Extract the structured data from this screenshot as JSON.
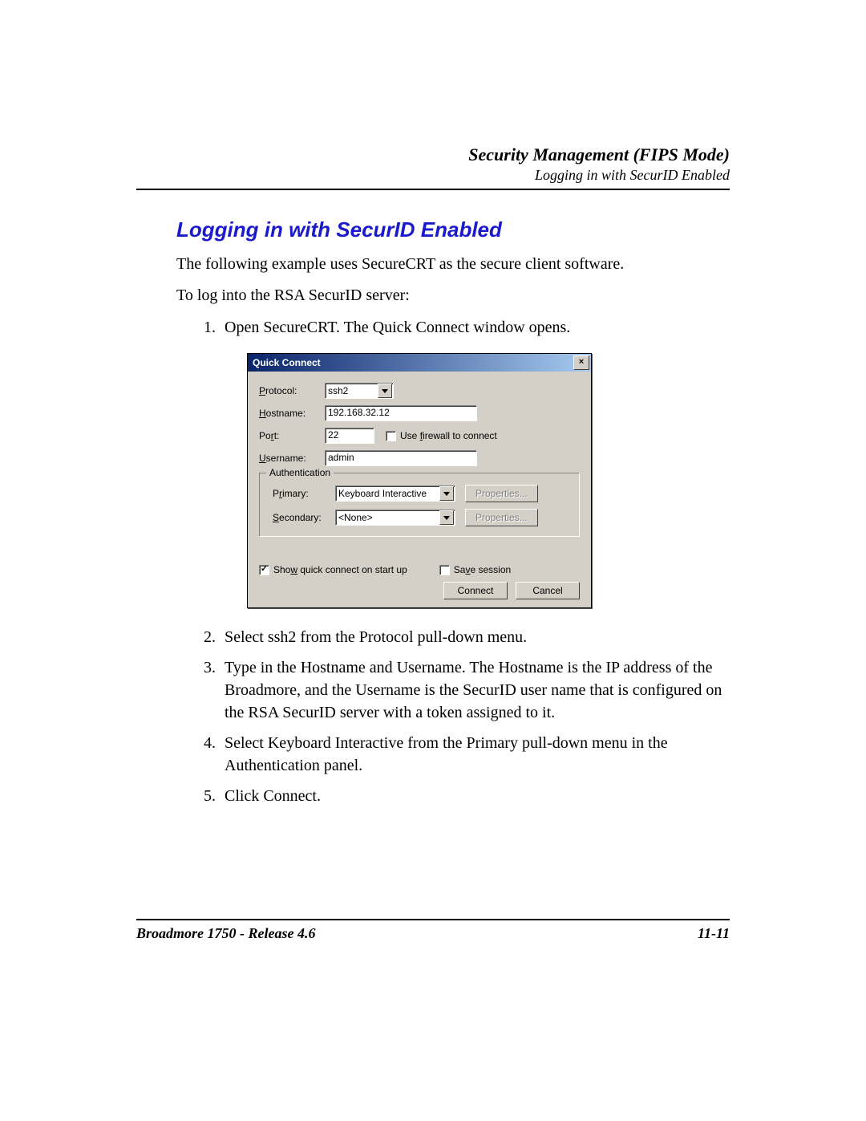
{
  "header": {
    "title": "Security Management (FIPS Mode)",
    "subtitle": "Logging in with SecurID Enabled"
  },
  "section_title": "Logging in with SecurID Enabled",
  "intro1": "The following example uses SecureCRT as the secure client software.",
  "intro2": "To log into the RSA SecurID server:",
  "step1": "Open SecureCRT. The Quick Connect window opens.",
  "step2": "Select ssh2 from the Protocol pull-down menu.",
  "step3": "Type in the Hostname and Username. The Hostname is the IP address of the Broadmore, and the Username is the SecurID user name that is configured on the RSA SecurID server with a token assigned to it.",
  "step4": "Select Keyboard Interactive from the Primary pull-down menu in the Authentication panel.",
  "step5": "Click Connect.",
  "dialog": {
    "title": "Quick Connect",
    "close_x": "×",
    "labels": {
      "protocol_pre": "P",
      "protocol_post": "rotocol:",
      "hostname_pre": "H",
      "hostname_post": "ostname:",
      "port_pre": "",
      "port_mid": "Po",
      "port_u": "r",
      "port_post": "t:",
      "username_pre": "U",
      "username_post": "sername:",
      "firewall_pre": "Use ",
      "firewall_u": "f",
      "firewall_post": "irewall to connect",
      "auth_legend": "Authentication",
      "primary_pre": "P",
      "primary_u": "r",
      "primary_post": "imary:",
      "secondary_pre": "S",
      "secondary_post": "econdary:",
      "props1": "Properties...",
      "props2": "Properties...",
      "showq_pre": "Sho",
      "showq_u": "w",
      "showq_post": " quick connect on start up",
      "save_pre": "Sa",
      "save_u": "v",
      "save_post": "e session",
      "connect": "Connect",
      "cancel": "Cancel"
    },
    "values": {
      "protocol": "ssh2",
      "hostname": "192.168.32.12",
      "port": "22",
      "username": "admin",
      "primary": "Keyboard Interactive",
      "secondary": "<None>"
    }
  },
  "footer": {
    "left": "Broadmore 1750 - Release 4.6",
    "right": "11-11"
  }
}
